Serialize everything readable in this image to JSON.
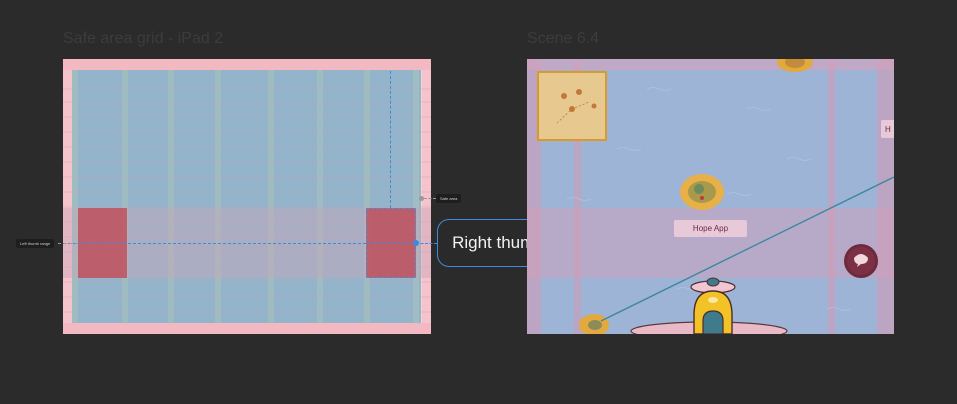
{
  "frames": {
    "grid_title": "Safe area grid - iPad 2",
    "scene_title": "Scene 6.4"
  },
  "annotations": {
    "left_thumb_label": "Left thumb range",
    "safe_area_label": "Safe area",
    "right_thumb_label": "Right thumb range"
  },
  "scene": {
    "app_button_label": "Hope App",
    "edge_button_label": "H"
  },
  "colors": {
    "canvas": "#2b2b2b",
    "selection_blue": "#3d8bd9",
    "thumb_zone_red": "#c0505e",
    "safe_area_blue": "#8fb1c9"
  }
}
